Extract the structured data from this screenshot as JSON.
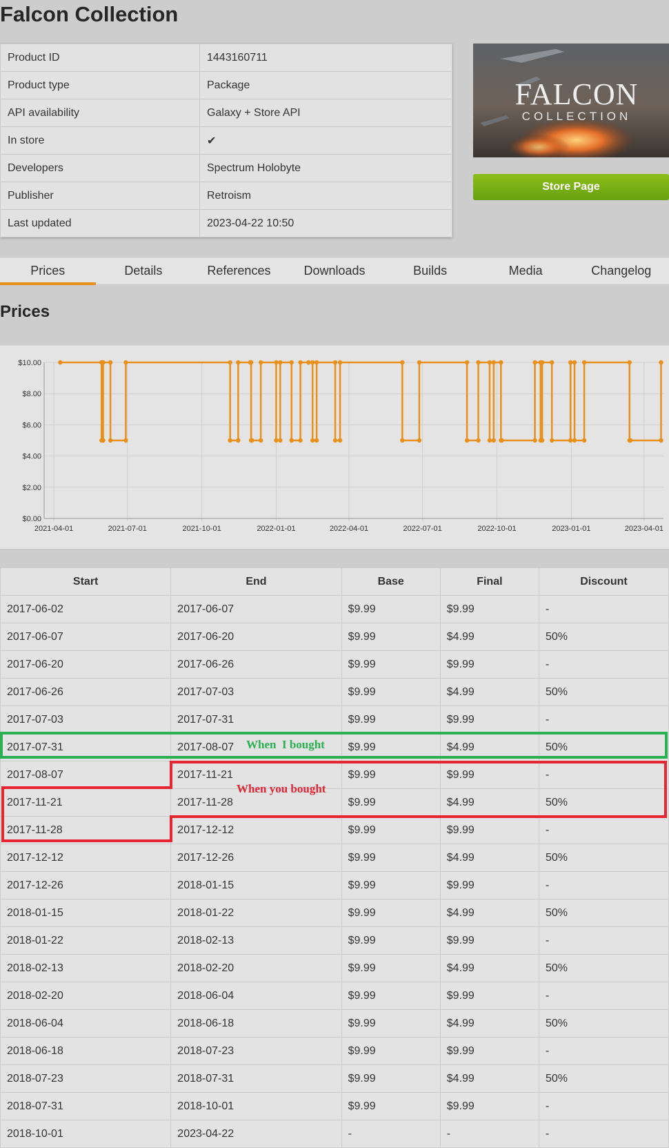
{
  "page_title": "Falcon Collection",
  "info_rows": [
    {
      "key": "Product ID",
      "value": "1443160711"
    },
    {
      "key": "Product type",
      "value": "Package"
    },
    {
      "key": "API availability",
      "value": "Galaxy + Store API"
    },
    {
      "key": "In store",
      "value": "✔"
    },
    {
      "key": "Developers",
      "value": "Spectrum Holobyte"
    },
    {
      "key": "Publisher",
      "value": "Retroism"
    },
    {
      "key": "Last updated",
      "value": "2023-04-22 10:50"
    }
  ],
  "cover": {
    "line1": "FALCON",
    "line2": "COLLECTION"
  },
  "store_button": "Store Page",
  "tabs": [
    "Prices",
    "Details",
    "References",
    "Downloads",
    "Builds",
    "Media",
    "Changelog"
  ],
  "active_tab": "Prices",
  "section_title": "Prices",
  "chart_data": {
    "type": "line",
    "step": true,
    "color": "#e8901b",
    "ylim": [
      0,
      10
    ],
    "y_ticks": [
      "$0.00",
      "$2.00",
      "$4.00",
      "$6.00",
      "$8.00",
      "$10.00"
    ],
    "x_ticks": [
      "2021-04-01",
      "2021-07-01",
      "2021-10-01",
      "2022-01-01",
      "2022-04-01",
      "2022-07-01",
      "2022-10-01",
      "2023-01-01",
      "2023-04-01"
    ],
    "xlim": [
      "2021-03-20",
      "2023-04-25"
    ],
    "series": [
      {
        "x": [
          "2021-04-09",
          "2021-05-30",
          "2021-05-31",
          "2021-06-01",
          "2021-06-10",
          "2021-06-29",
          "2021-11-05",
          "2021-11-15",
          "2021-11-30",
          "2021-12-01",
          "2021-12-02",
          "2021-12-13",
          "2022-01-01",
          "2022-01-06",
          "2022-01-20",
          "2022-01-31",
          "2022-02-10",
          "2022-02-15",
          "2022-02-20",
          "2022-03-15",
          "2022-03-21",
          "2022-06-06",
          "2022-06-27",
          "2022-08-25",
          "2022-09-08",
          "2022-09-22",
          "2022-09-27",
          "2022-10-06",
          "2022-10-07",
          "2022-11-17",
          "2022-11-24",
          "2022-11-26",
          "2022-12-08",
          "2022-12-31",
          "2023-01-05",
          "2023-01-17",
          "2023-03-14",
          "2023-03-15",
          "2023-04-22"
        ],
        "y": [
          10,
          5,
          5,
          10,
          5,
          10,
          5,
          10,
          10,
          5,
          5,
          10,
          5,
          10,
          5,
          10,
          10,
          5,
          10,
          5,
          10,
          5,
          10,
          5,
          10,
          5,
          10,
          5,
          5,
          10,
          5,
          10,
          5,
          10,
          5,
          10,
          5,
          5,
          10
        ]
      }
    ]
  },
  "table": {
    "headers": [
      "Start",
      "End",
      "Base",
      "Final",
      "Discount"
    ],
    "rows": [
      [
        "2017-06-02",
        "2017-06-07",
        "$9.99",
        "$9.99",
        "-"
      ],
      [
        "2017-06-07",
        "2017-06-20",
        "$9.99",
        "$4.99",
        "50%"
      ],
      [
        "2017-06-20",
        "2017-06-26",
        "$9.99",
        "$9.99",
        "-"
      ],
      [
        "2017-06-26",
        "2017-07-03",
        "$9.99",
        "$4.99",
        "50%"
      ],
      [
        "2017-07-03",
        "2017-07-31",
        "$9.99",
        "$9.99",
        "-"
      ],
      [
        "2017-07-31",
        "2017-08-07",
        "$9.99",
        "$4.99",
        "50%"
      ],
      [
        "2017-08-07",
        "2017-11-21",
        "$9.99",
        "$9.99",
        "-"
      ],
      [
        "2017-11-21",
        "2017-11-28",
        "$9.99",
        "$4.99",
        "50%"
      ],
      [
        "2017-11-28",
        "2017-12-12",
        "$9.99",
        "$9.99",
        "-"
      ],
      [
        "2017-12-12",
        "2017-12-26",
        "$9.99",
        "$4.99",
        "50%"
      ],
      [
        "2017-12-26",
        "2018-01-15",
        "$9.99",
        "$9.99",
        "-"
      ],
      [
        "2018-01-15",
        "2018-01-22",
        "$9.99",
        "$4.99",
        "50%"
      ],
      [
        "2018-01-22",
        "2018-02-13",
        "$9.99",
        "$9.99",
        "-"
      ],
      [
        "2018-02-13",
        "2018-02-20",
        "$9.99",
        "$4.99",
        "50%"
      ],
      [
        "2018-02-20",
        "2018-06-04",
        "$9.99",
        "$9.99",
        "-"
      ],
      [
        "2018-06-04",
        "2018-06-18",
        "$9.99",
        "$4.99",
        "50%"
      ],
      [
        "2018-06-18",
        "2018-07-23",
        "$9.99",
        "$9.99",
        "-"
      ],
      [
        "2018-07-23",
        "2018-07-31",
        "$9.99",
        "$4.99",
        "50%"
      ],
      [
        "2018-07-31",
        "2018-10-01",
        "$9.99",
        "$9.99",
        "-"
      ],
      [
        "2018-10-01",
        "2023-04-22",
        "-",
        "-",
        "-"
      ]
    ]
  },
  "annotations": {
    "green_text": "When  I bought",
    "green_color": "#2ab050",
    "red_text": "When you bought",
    "red_color": "#e52531"
  }
}
